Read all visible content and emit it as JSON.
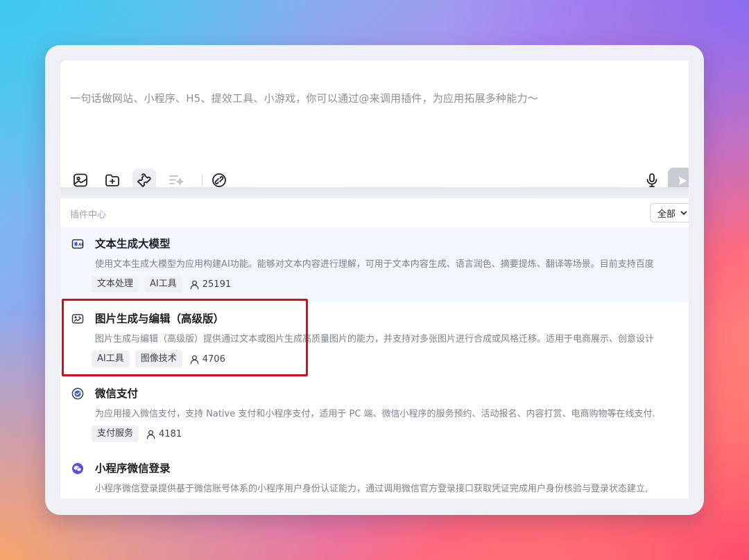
{
  "input": {
    "placeholder": "一句话做网站、小程序、H5、提效工具、小游戏，你可以通过@来调用插件，为应用拓展多种能力～"
  },
  "toolbar": {
    "tools": [
      {
        "icon": "image-upload-icon"
      },
      {
        "icon": "folder-add-icon"
      },
      {
        "icon": "plugin-puzzle-icon",
        "active": true
      },
      {
        "icon": "prompt-enhance-icon",
        "disabled": true
      },
      {
        "icon": "link-icon"
      }
    ],
    "mic_icon": "microphone-icon",
    "send_icon": "send-icon"
  },
  "plugin_center": {
    "title": "插件中心",
    "filter": {
      "selected": "全部"
    },
    "items": [
      {
        "name": "文本生成大模型",
        "description": "使用文本生成大模型为应用构建AI功能。能够对文本内容进行理解，可用于文本内容生成、语言润色、摘要提炼、翻译等场景。目前支持百度",
        "tags": [
          "文本处理",
          "AI工具"
        ],
        "users": "25191",
        "icon": "text-model-icon"
      },
      {
        "name": "图片生成与编辑（高级版）",
        "description": "图片生成与编辑（高级版）提供通过文本或图片生成高质量图片的能力，并支持对多张图片进行合成或风格迁移。适用于电商展示、创意设计",
        "tags": [
          "AI工具",
          "图像技术"
        ],
        "users": "4706",
        "icon": "image-edit-icon"
      },
      {
        "name": "微信支付",
        "description": "为应用接入微信支付，支持 Native 支付和小程序支付，适用于 PC 端、微信小程序的服务预约、活动报名、内容打赏、电商购物等在线支付.",
        "tags": [
          "支付服务"
        ],
        "users": "4181",
        "icon": "wechat-pay-icon"
      },
      {
        "name": "小程序微信登录",
        "description": "小程序微信登录提供基于微信账号体系的小程序用户身份认证能力，通过调用微信官方登录接口获取凭证完成用户身份核验与登录状态建立,",
        "tags": [],
        "users": "",
        "icon": "wechat-login-icon"
      }
    ]
  },
  "colors": {
    "highlight_border": "#d0101d",
    "wechat_pay": "#3b5bdb",
    "wechat_login": "#5a4fe0"
  }
}
